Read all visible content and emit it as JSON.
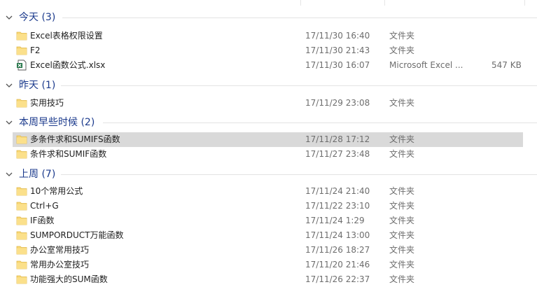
{
  "colors": {
    "group_title": "#1b3a8c",
    "folder": "#f8d775",
    "selected_row": "#d9d9d9"
  },
  "groups": [
    {
      "title": "今天 (3)",
      "items": [
        {
          "name": "Excel表格权限设置",
          "date": "17/11/30 16:40",
          "type": "文件夹",
          "size": "",
          "icon": "folder-icon"
        },
        {
          "name": "F2",
          "date": "17/11/30 21:43",
          "type": "文件夹",
          "size": "",
          "icon": "folder-icon"
        },
        {
          "name": "Excel函数公式.xlsx",
          "date": "17/11/30 16:07",
          "type": "Microsoft Excel ...",
          "size": "547 KB",
          "icon": "excel-file-icon"
        }
      ]
    },
    {
      "title": "昨天 (1)",
      "items": [
        {
          "name": "实用技巧",
          "date": "17/11/29 23:08",
          "type": "文件夹",
          "size": "",
          "icon": "folder-icon"
        }
      ]
    },
    {
      "title": "本周早些时候 (2)",
      "items": [
        {
          "name": "多条件求和SUMIFS函数",
          "date": "17/11/28 17:12",
          "type": "文件夹",
          "size": "",
          "icon": "folder-icon",
          "selected": true
        },
        {
          "name": "条件求和SUMIF函数",
          "date": "17/11/27 23:48",
          "type": "文件夹",
          "size": "",
          "icon": "folder-icon"
        }
      ]
    },
    {
      "title": "上周 (7)",
      "items": [
        {
          "name": "10个常用公式",
          "date": "17/11/24 21:40",
          "type": "文件夹",
          "size": "",
          "icon": "folder-icon"
        },
        {
          "name": "Ctrl+G",
          "date": "17/11/22 23:10",
          "type": "文件夹",
          "size": "",
          "icon": "folder-icon"
        },
        {
          "name": "IF函数",
          "date": "17/11/24 1:29",
          "type": "文件夹",
          "size": "",
          "icon": "folder-icon"
        },
        {
          "name": "SUMPORDUCT万能函数",
          "date": "17/11/24 13:00",
          "type": "文件夹",
          "size": "",
          "icon": "folder-icon"
        },
        {
          "name": "办公室常用技巧",
          "date": "17/11/26 18:27",
          "type": "文件夹",
          "size": "",
          "icon": "folder-icon"
        },
        {
          "name": "常用办公室技巧",
          "date": "17/11/20 21:46",
          "type": "文件夹",
          "size": "",
          "icon": "folder-icon"
        },
        {
          "name": "功能强大的SUM函数",
          "date": "17/11/26 22:37",
          "type": "文件夹",
          "size": "",
          "icon": "folder-icon"
        }
      ]
    }
  ]
}
